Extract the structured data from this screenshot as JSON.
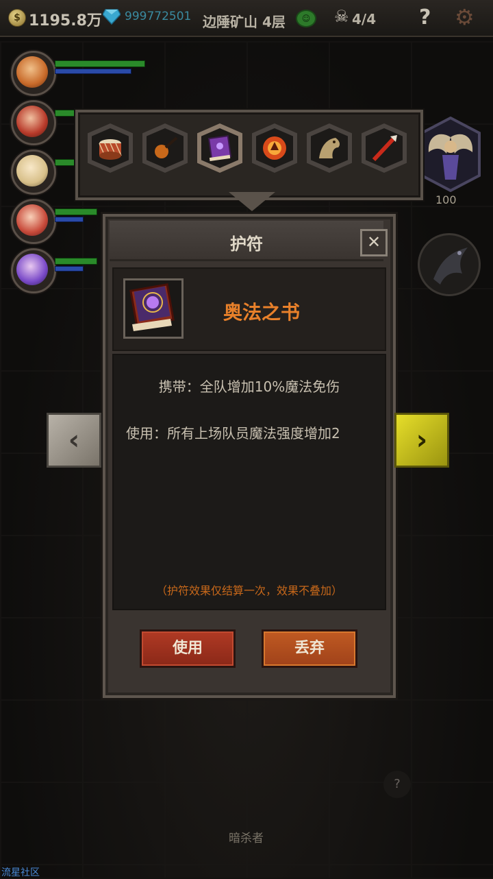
{
  "topbar": {
    "gold": "1195.8万",
    "gems": "999772501",
    "location": "边陲矿山 4层",
    "skull_count": "4/4",
    "help_glyph": "?",
    "icons": [
      "coin-icon",
      "diamond-icon",
      "face-icon",
      "skull-icon",
      "help-icon",
      "gear-icon"
    ]
  },
  "party": {
    "members": [
      {
        "name": "member-1",
        "color": "#c86a2a"
      },
      {
        "name": "member-2",
        "color": "#b83a2a"
      },
      {
        "name": "member-3",
        "color": "#d8c08a"
      },
      {
        "name": "member-4",
        "color": "#c84a3a"
      },
      {
        "name": "member-5",
        "color": "#7a4ac8"
      }
    ]
  },
  "amulets": {
    "slots": [
      "drum",
      "smoking-pipe",
      "arcane-book",
      "phoenix-orb",
      "griffin-head",
      "fire-arrow"
    ],
    "selected_index": 2
  },
  "right_panel": {
    "angel_level": "100"
  },
  "modal": {
    "title": "护符",
    "close_label": "✕",
    "item_name": "奥法之书",
    "carry_effect": "携带：全队增加10%魔法免伤",
    "use_effect": "使用：所有上场队员魔法强度增加2",
    "note": "（护符效果仅结算一次，效果不叠加）",
    "use_button": "使用",
    "discard_button": "丢弃"
  },
  "navigation": {
    "prev_label": "‹",
    "next_label": "›"
  },
  "world": {
    "enemy_label": "暗杀者",
    "hint_glyph": "?"
  },
  "watermark": "流星社区",
  "colors": {
    "item_name": "#e8802a",
    "note": "#c8681a",
    "next_arrow": "#e6de2a"
  }
}
